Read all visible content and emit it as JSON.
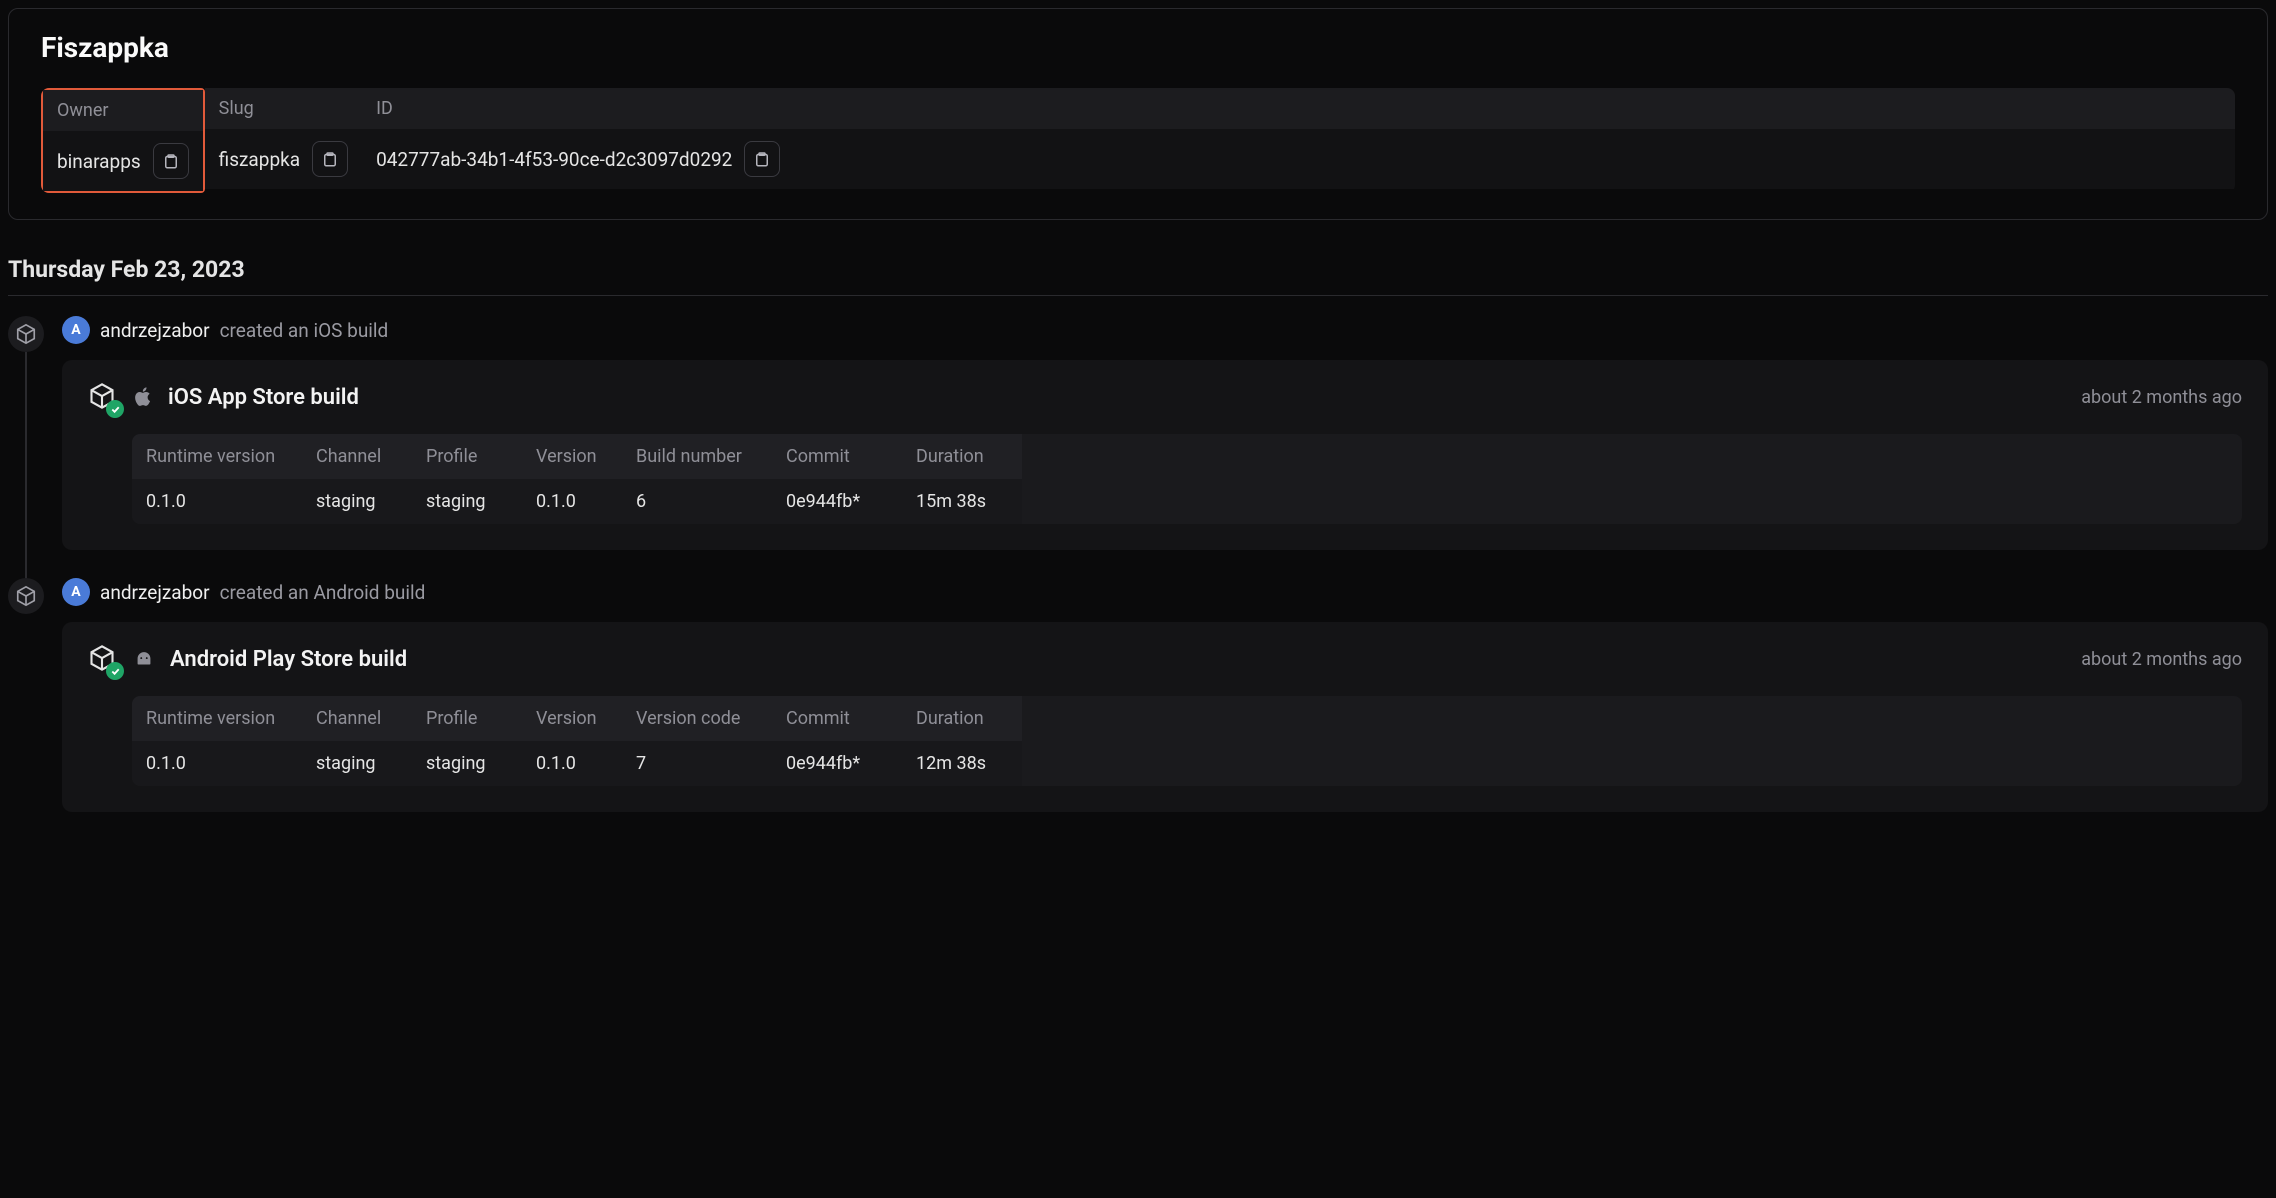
{
  "project": {
    "title": "Fiszappka",
    "meta": {
      "owner_label": "Owner",
      "owner_value": "binarapps",
      "slug_label": "Slug",
      "slug_value": "fiszappka",
      "id_label": "ID",
      "id_value": "042777ab-34b1-4f53-90ce-d2c3097d0292"
    }
  },
  "date_header": "Thursday Feb 23, 2023",
  "events": [
    {
      "avatar_letter": "A",
      "user": "andrzejzabor",
      "action": " created an iOS build",
      "build": {
        "platform": "ios",
        "title": "iOS App Store build",
        "time_ago": "about 2 months ago",
        "columns": [
          "Runtime version",
          "Channel",
          "Profile",
          "Version",
          "Build number",
          "Commit",
          "Duration"
        ],
        "values": [
          "0.1.0",
          "staging",
          "staging",
          "0.1.0",
          "6",
          "0e944fb*",
          "15m 38s"
        ]
      }
    },
    {
      "avatar_letter": "A",
      "user": "andrzejzabor",
      "action": " created an Android build",
      "build": {
        "platform": "android",
        "title": "Android Play Store build",
        "time_ago": "about 2 months ago",
        "columns": [
          "Runtime version",
          "Channel",
          "Profile",
          "Version",
          "Version code",
          "Commit",
          "Duration"
        ],
        "values": [
          "0.1.0",
          "staging",
          "staging",
          "0.1.0",
          "7",
          "0e944fb*",
          "12m 38s"
        ]
      }
    }
  ]
}
